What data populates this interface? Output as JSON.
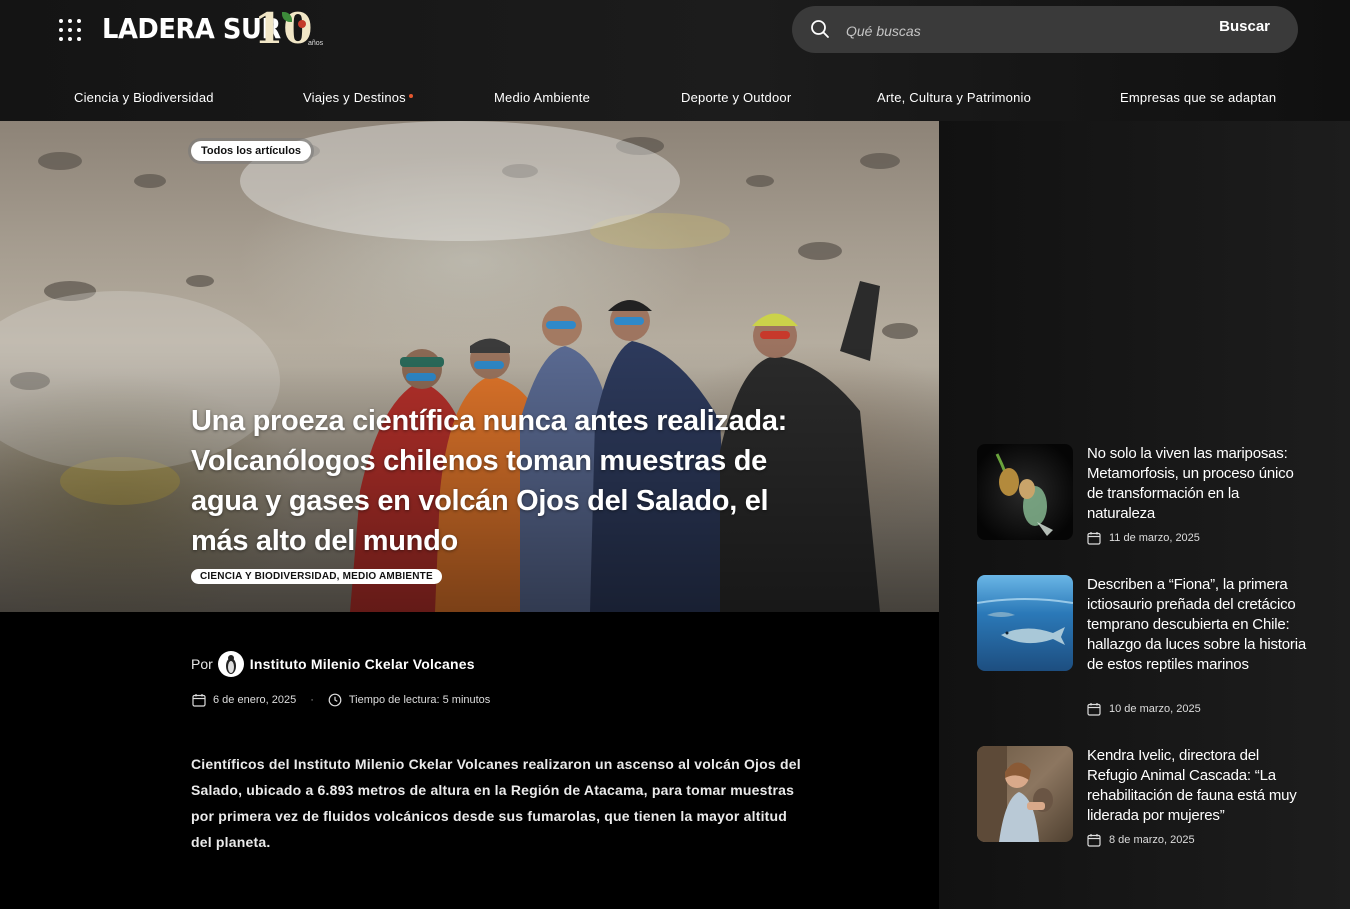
{
  "header": {
    "logo_text": "LADERA SUR",
    "logo_anniversary": "10",
    "logo_anos": "años",
    "search": {
      "placeholder": "Qué buscas",
      "button_label": "Buscar"
    }
  },
  "nav": {
    "items": [
      {
        "label": "Ciencia y Biodiversidad"
      },
      {
        "label": "Viajes y Destinos"
      },
      {
        "label": "Medio Ambiente"
      },
      {
        "label": "Deporte y Outdoor"
      },
      {
        "label": "Arte, Cultura y Patrimonio"
      },
      {
        "label": "Empresas que se adaptan"
      }
    ]
  },
  "article": {
    "all_articles_label": "Todos los artículos",
    "title": "Una proeza científica nunca antes realizada: Volcanólogos chilenos toman muestras de agua y gases en volcán Ojos del Salado, el más alto del mundo",
    "categories": "CIENCIA Y BIODIVERSIDAD, MEDIO AMBIENTE",
    "byline_prefix": "Por",
    "author": "Instituto Milenio Ckelar Volcanes",
    "date": "6 de enero, 2025",
    "separator": "·",
    "reading_time": "Tiempo de lectura: 5 minutos",
    "lead": "Científicos del Instituto Milenio Ckelar Volcanes realizaron un ascenso al volcán Ojos del Salado, ubicado a 6.893 metros de altura en la Región de Atacama, para tomar muestras por primera vez de fluidos volcánicos desde sus fumarolas, que tienen la mayor altitud del planeta."
  },
  "sidebar": {
    "items": [
      {
        "title": "No solo la viven las mariposas: Metamorfosis, un proceso único de transformación en la naturaleza",
        "date": "11 de marzo, 2025"
      },
      {
        "title": "Describen a “Fiona”, la primera ictiosaurio preñada del cretácico temprano descubierta en Chile: hallazgo da luces sobre la historia de estos reptiles marinos",
        "date": "10 de marzo, 2025"
      },
      {
        "title": "Kendra Ivelic, directora del Refugio Animal Cascada: “La rehabilitación de fauna está muy liderada por mujeres”",
        "date": "8 de marzo, 2025"
      }
    ]
  },
  "colors": {
    "background": "#000000",
    "sidebar": "#1a1a1a",
    "search_bg": "#3a3a3a",
    "nav_dot": "#e4572e",
    "tag_bg": "#ffffff"
  }
}
